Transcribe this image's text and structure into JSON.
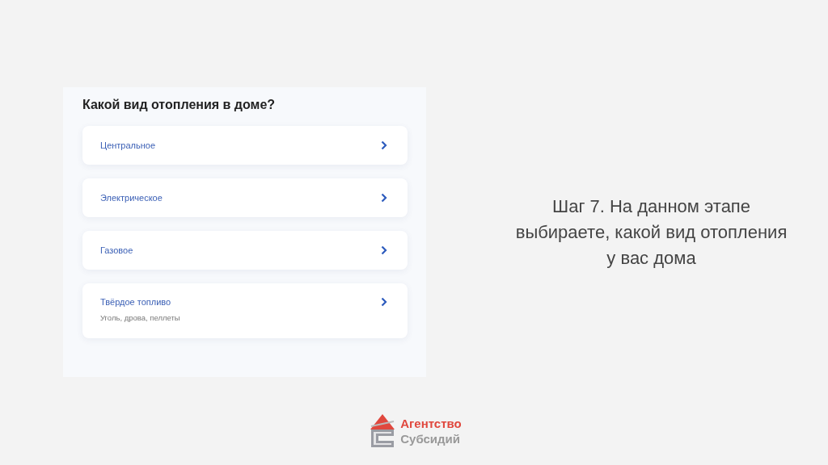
{
  "panel": {
    "title": "Какой вид отопления в доме?",
    "options": [
      {
        "label": "Центральное"
      },
      {
        "label": "Электрическое"
      },
      {
        "label": "Газовое"
      },
      {
        "label": "Твёрдое топливо",
        "hint": "Уголь, дрова, пеллеты"
      }
    ]
  },
  "caption": "Шаг 7. На данном этапе выбираете, какой вид отопления у вас дома",
  "logo": {
    "line_1": "Агентство",
    "line_2": "Субсидий"
  }
}
